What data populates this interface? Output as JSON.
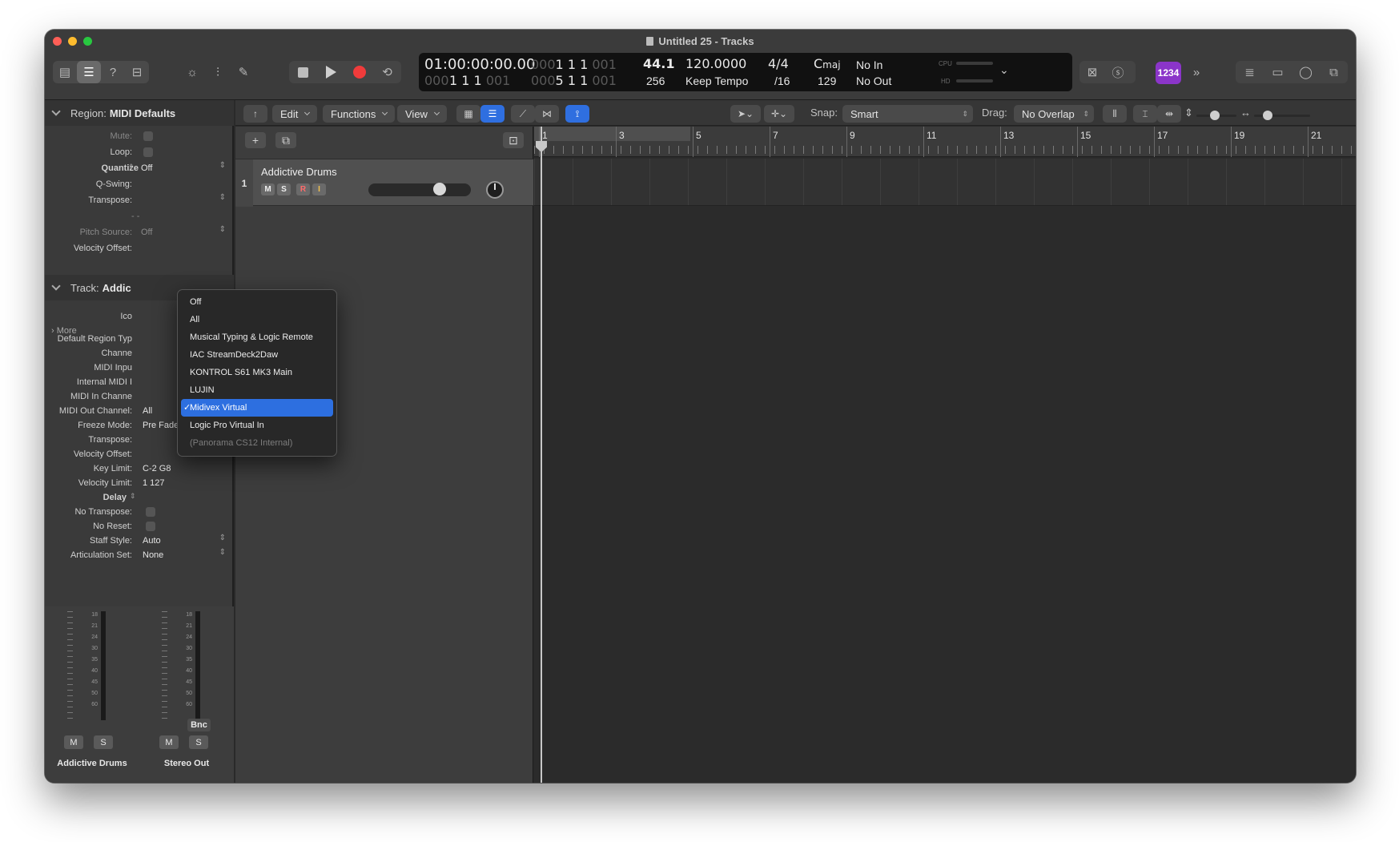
{
  "window": {
    "title": "Untitled 25 - Tracks"
  },
  "control_bar": {
    "icons": [
      "library-icon",
      "inspector-icon",
      "help-icon",
      "toolbar-icon",
      "smart-controls-icon",
      "mixer-icon",
      "editors-icon"
    ],
    "transport": [
      "stop-icon",
      "play-icon",
      "record-icon",
      "cycle-icon"
    ]
  },
  "lcd": {
    "smpte": "01:00:00:00.00",
    "position_top_dim": "000",
    "position_top": "1  1  1",
    "position_top_end_dim": "001",
    "position_bot_dim": "000",
    "position_bot": "1  1  1",
    "position_bot_end_dim": "001",
    "loop_top_dim": "000",
    "loop_top": "1  1  1",
    "loop_top_end_dim": "001",
    "loop_bot_dim": "000",
    "loop_bot": "5  1  1",
    "loop_bot_end_dim": "001",
    "sample_rate": "44.1",
    "buffer": "256",
    "tempo": "120.0000",
    "tempo_mode": "Keep Tempo",
    "time_sig": "4/4",
    "division": "/16",
    "key": "C",
    "key_mode": "maj",
    "key_value": "129",
    "midi_in": "No In",
    "midi_out": "No Out",
    "cpu_label": "CPU",
    "hd_label": "HD"
  },
  "badge": {
    "label": "1234"
  },
  "region_inspector": {
    "header_label": "Region:",
    "header_value": "MIDI Defaults",
    "rows": [
      {
        "label": "Mute:",
        "value": ""
      },
      {
        "label": "Loop:",
        "value": ""
      },
      {
        "label": "Quantize",
        "value": "Off"
      },
      {
        "label": "Q-Swing:",
        "value": ""
      },
      {
        "label": "Transpose:",
        "value": ""
      },
      {
        "label": "",
        "value": "- -"
      },
      {
        "label": "Pitch Source:",
        "value": "Off"
      },
      {
        "label": "Velocity Offset:",
        "value": ""
      }
    ],
    "more": "More"
  },
  "track_inspector": {
    "header_label": "Track:",
    "header_value": "Addic",
    "rows": [
      {
        "label": "Ico",
        "value": ""
      },
      {
        "label": "Default Region Typ",
        "value": ""
      },
      {
        "label": "Channe",
        "value": ""
      },
      {
        "label": "MIDI Inpu",
        "value": ""
      },
      {
        "label": "Internal MIDI I",
        "value": ""
      },
      {
        "label": "MIDI In Channe",
        "value": ""
      },
      {
        "label": "MIDI Out Channel:",
        "value": "All"
      },
      {
        "label": "Freeze Mode:",
        "value": "Pre Fader"
      },
      {
        "label": "Transpose:",
        "value": ""
      },
      {
        "label": "Velocity Offset:",
        "value": ""
      },
      {
        "label": "Key Limit:",
        "value": "C-2  G8"
      },
      {
        "label": "Velocity Limit:",
        "value": "1  127"
      },
      {
        "label": "Delay",
        "value": ""
      },
      {
        "label": "No Transpose:",
        "value": ""
      },
      {
        "label": "No Reset:",
        "value": ""
      },
      {
        "label": "Staff Style:",
        "value": "Auto"
      },
      {
        "label": "Articulation Set:",
        "value": "None"
      }
    ]
  },
  "channel_strips": {
    "scale": [
      "18",
      "21",
      "24",
      "30",
      "35",
      "40",
      "45",
      "50",
      "60"
    ],
    "strips": [
      {
        "name": "Addictive Drums",
        "mute": "M",
        "solo": "S"
      },
      {
        "name": "Stereo Out",
        "mute": "M",
        "solo": "S",
        "bounce": "Bnc"
      }
    ]
  },
  "toolbar": {
    "edit": "Edit",
    "functions": "Functions",
    "view": "View",
    "snap_label": "Snap:",
    "snap_value": "Smart",
    "drag_label": "Drag:",
    "drag_value": "No Overlap"
  },
  "tracks": [
    {
      "number": "1",
      "name": "Addictive Drums",
      "mute": "M",
      "solo": "S",
      "record": "R",
      "input": "I",
      "volume": 0.62
    }
  ],
  "ruler": {
    "bars": [
      "1",
      "3",
      "5",
      "7",
      "9",
      "11",
      "13",
      "15",
      "17",
      "19",
      "21"
    ]
  },
  "midi_input_menu": {
    "items": [
      {
        "label": "Off",
        "state": "normal"
      },
      {
        "label": "All",
        "state": "normal"
      },
      {
        "label": "Musical Typing & Logic Remote",
        "state": "normal"
      },
      {
        "label": "IAC StreamDeck2Daw",
        "state": "normal"
      },
      {
        "label": "KONTROL S61 MK3 Main",
        "state": "normal"
      },
      {
        "label": "LUJIN",
        "state": "normal"
      },
      {
        "label": "Midivex Virtual",
        "state": "selected"
      },
      {
        "label": "Logic Pro Virtual In",
        "state": "normal"
      },
      {
        "label": "(Panorama CS12 Internal)",
        "state": "disabled"
      }
    ],
    "check_mark": "✓"
  }
}
